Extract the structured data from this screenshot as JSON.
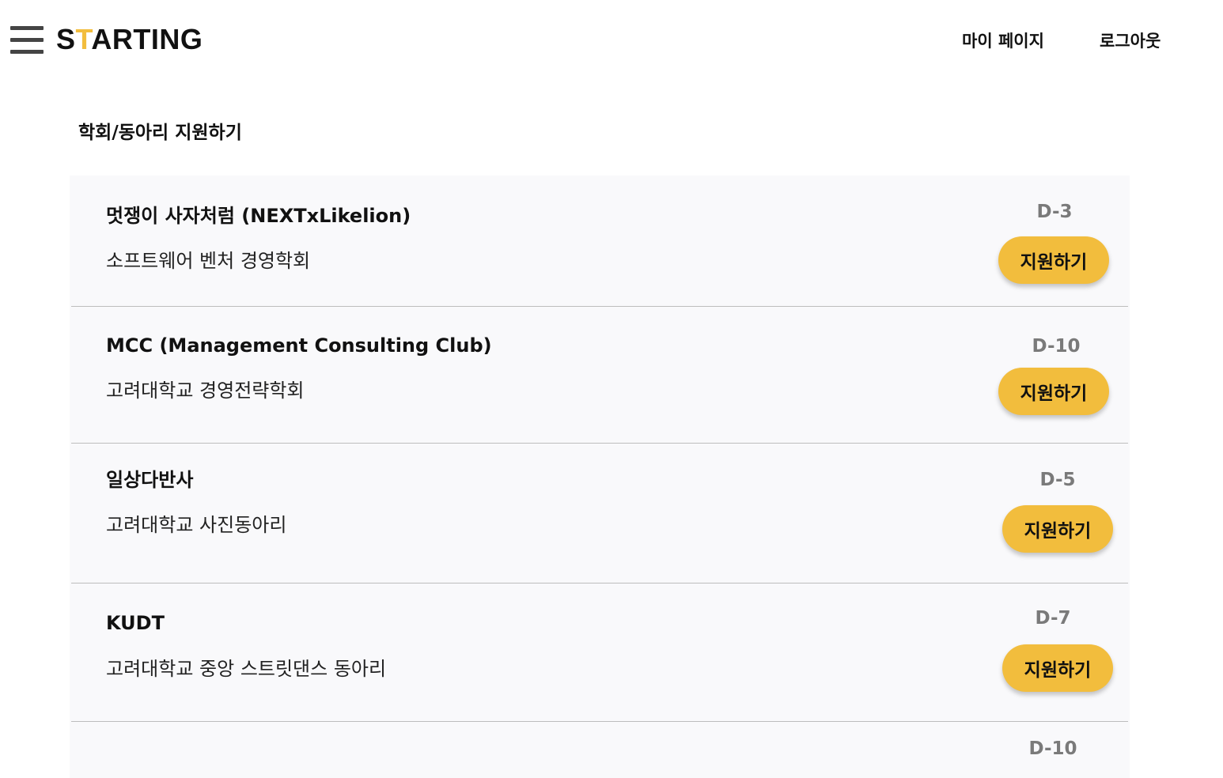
{
  "app": {
    "logo_prefix": "S",
    "logo_accent": "T",
    "logo_suffix": "ARTING",
    "accent_color": "#F2BD3D"
  },
  "header": {
    "menu_icon": "hamburger-menu-icon",
    "my_page_label": "마이 페이지",
    "logout_label": "로그아웃"
  },
  "page": {
    "title": "학회/동아리 지원하기"
  },
  "clubs": [
    {
      "name": "멋쟁이 사자처럼 (NEXTxLikelion)",
      "description": "소프트웨어 벤처 경영학회",
      "dday": "D-3",
      "apply_label": "지원하기"
    },
    {
      "name": "MCC (Management Consulting Club)",
      "description": "고려대학교 경영전략학회",
      "dday": "D-10",
      "apply_label": "지원하기"
    },
    {
      "name": "일상다반사",
      "description": "고려대학교 사진동아리",
      "dday": "D-5",
      "apply_label": "지원하기"
    },
    {
      "name": "KUDT",
      "description": "고려대학교 중앙 스트릿댄스 동아리",
      "dday": "D-7",
      "apply_label": "지원하기"
    },
    {
      "name": "",
      "description": "",
      "dday": "D-10",
      "apply_label": ""
    }
  ]
}
